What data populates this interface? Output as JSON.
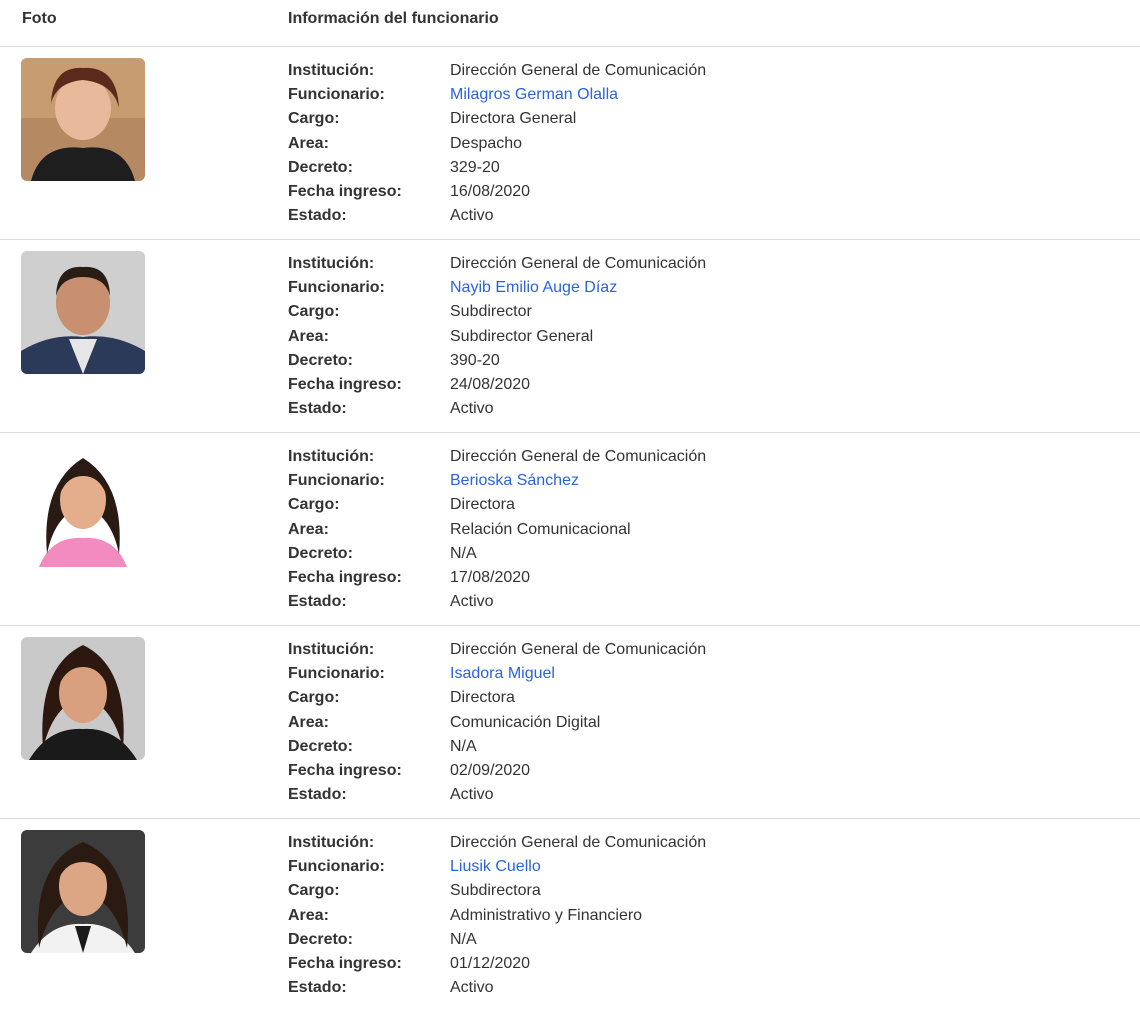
{
  "header": {
    "col_photo": "Foto",
    "col_info": "Información del funcionario"
  },
  "labels": {
    "institucion": "Institución:",
    "funcionario": "Funcionario:",
    "cargo": "Cargo:",
    "area": "Area:",
    "decreto": "Decreto:",
    "fecha": "Fecha ingreso:",
    "estado": "Estado:"
  },
  "colors": {
    "link": "#2a63e0",
    "text": "#333333",
    "divider": "#dcdcdc"
  },
  "officials": [
    {
      "institucion": "Dirección General de Comunicación",
      "funcionario": "Milagros German Olalla",
      "cargo": "Directora General",
      "area": "Despacho",
      "decreto": "329-20",
      "fecha": "16/08/2020",
      "estado": "Activo"
    },
    {
      "institucion": "Dirección General de Comunicación",
      "funcionario": "Nayib Emilio Auge Díaz",
      "cargo": "Subdirector",
      "area": "Subdirector General",
      "decreto": "390-20",
      "fecha": "24/08/2020",
      "estado": "Activo"
    },
    {
      "institucion": "Dirección General de Comunicación",
      "funcionario": "Berioska Sánchez",
      "cargo": "Directora",
      "area": "Relación Comunicacional",
      "decreto": "N/A",
      "fecha": "17/08/2020",
      "estado": "Activo"
    },
    {
      "institucion": "Dirección General de Comunicación",
      "funcionario": "Isadora Miguel",
      "cargo": "Directora",
      "area": "Comunicación Digital",
      "decreto": "N/A",
      "fecha": "02/09/2020",
      "estado": "Activo"
    },
    {
      "institucion": "Dirección General de Comunicación",
      "funcionario": "Liusik Cuello",
      "cargo": "Subdirectora",
      "area": "Administrativo y Financiero",
      "decreto": "N/A",
      "fecha": "01/12/2020",
      "estado": "Activo"
    }
  ]
}
